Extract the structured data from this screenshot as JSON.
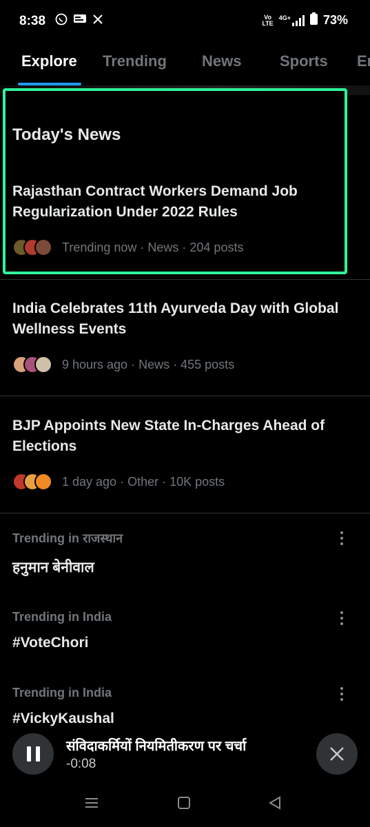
{
  "status_bar": {
    "time": "8:38",
    "left_icons": [
      "whatsapp-icon",
      "news-app-icon",
      "x-icon"
    ],
    "network_top": "Vo",
    "network_bottom": "LTE",
    "signal": "4G+",
    "battery": "73%"
  },
  "tabs": [
    "Explore",
    "Trending",
    "News",
    "Sports",
    "En"
  ],
  "active_tab": "Explore",
  "todays_news": {
    "heading": "Today's News",
    "items": [
      {
        "title": "Rajasthan Contract Workers Demand Job Regularization Under 2022 Rules",
        "meta": "Trending now · News · 204 posts",
        "avatar_colors": [
          "#6b5a2a",
          "#b23a2f",
          "#7b4a3a"
        ]
      },
      {
        "title": "India Celebrates 11th Ayurveda Day with Global Wellness Events",
        "meta": "9 hours ago · News · 455 posts",
        "avatar_colors": [
          "#d9a27a",
          "#a8527a",
          "#cfc0a8"
        ]
      },
      {
        "title": "BJP Appoints New State In-Charges Ahead of Elections",
        "meta": "1 day ago · Other · 10K posts",
        "avatar_colors": [
          "#c0392b",
          "#e8a040",
          "#f08a24"
        ]
      }
    ]
  },
  "trends": [
    {
      "label": "Trending in राजस्थान",
      "name": "हनुमान बेनीवाल"
    },
    {
      "label": "Trending in India",
      "name": "#VoteChori"
    },
    {
      "label": "Trending in India",
      "name": "#VickyKaushal"
    }
  ],
  "player": {
    "title": "संविदाकर्मियों नियमितीकरण पर चर्चा",
    "time": "-0:08"
  },
  "colors": {
    "highlight": "#2ef39a",
    "muted_text": "#71767b",
    "accent": "#1d9bf0"
  }
}
